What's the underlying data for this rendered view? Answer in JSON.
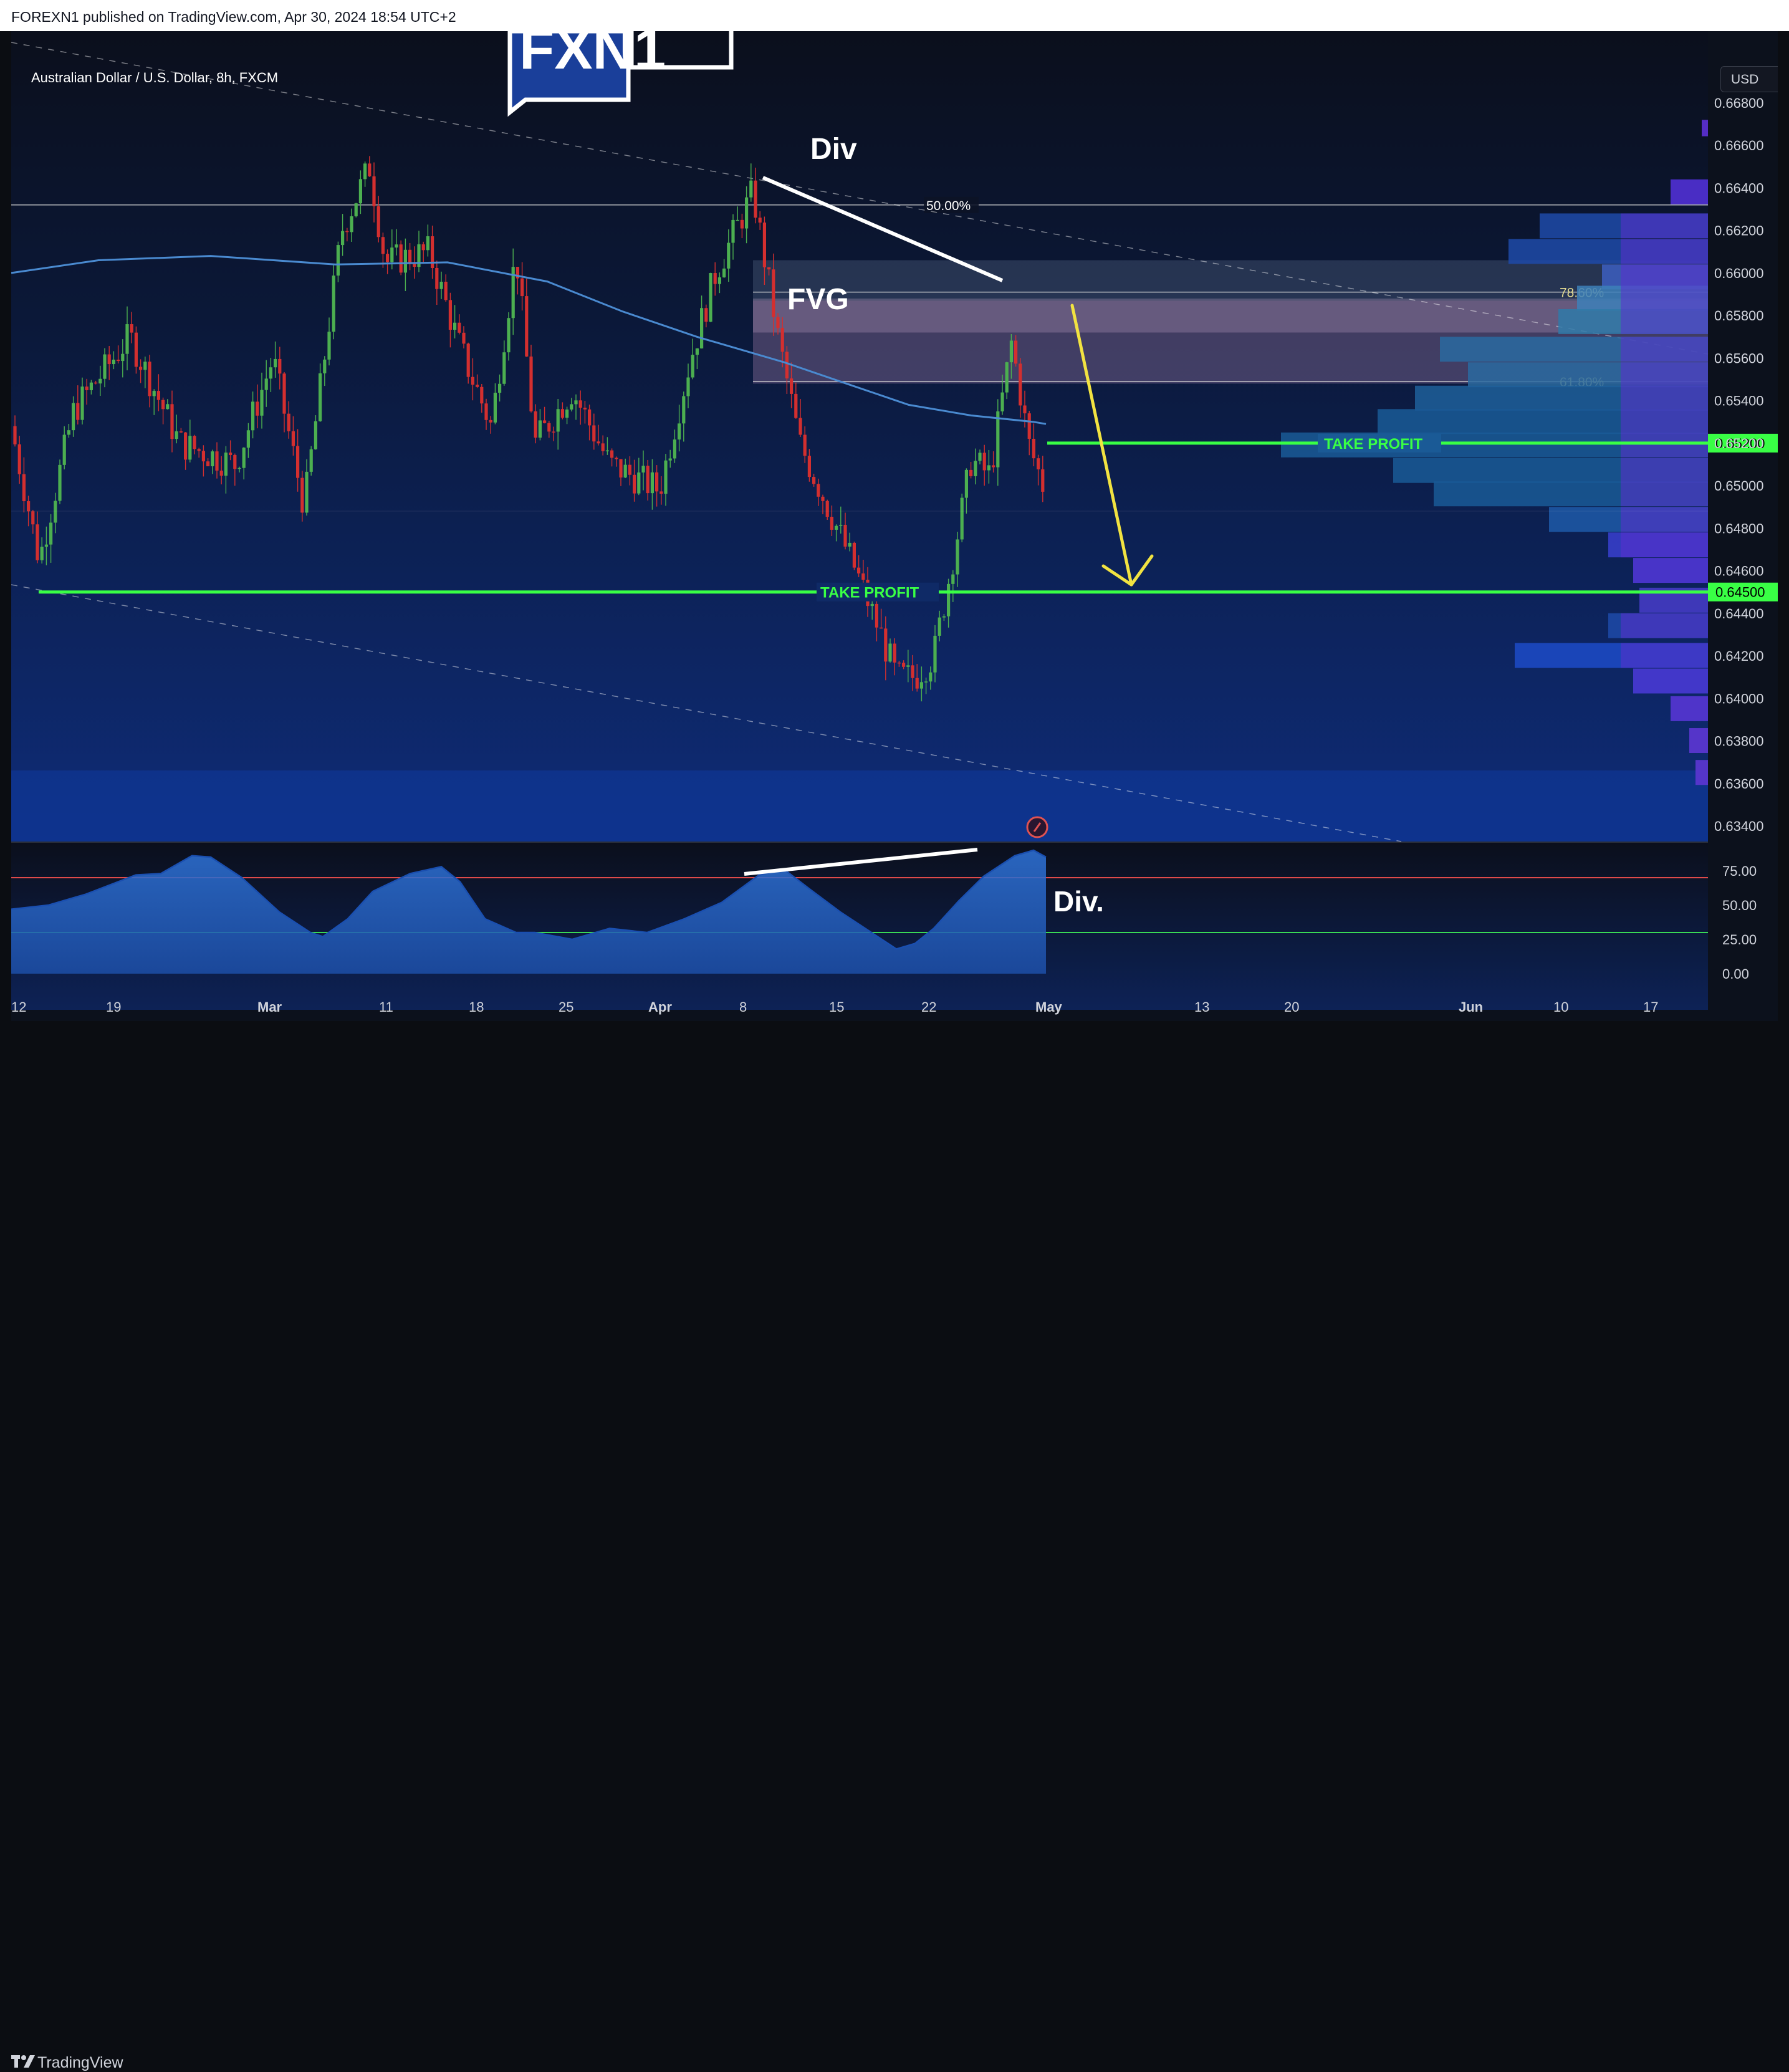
{
  "header": {
    "published": "FOREXN1 published on TradingView.com, Apr 30, 2024 18:54 UTC+2"
  },
  "symbol": {
    "title": "Australian Dollar / U.S. Dollar, 8h, FXCM"
  },
  "currency": "USD",
  "watermark": {
    "text": "FXN1"
  },
  "footer": {
    "brand": "TradingView"
  },
  "annotations": {
    "div_top": "Div",
    "div_bottom": "Div.",
    "fvg": "FVG",
    "take_profit_1": "TAKE PROFIT",
    "take_profit_2": "TAKE PROFIT"
  },
  "colors": {
    "up": "#4caf50",
    "down": "#d32f2f",
    "take_profit": "#39ff45",
    "moving_average": "#4a8ad0",
    "rsi_fill": "#2d6fd1",
    "overbought": "#e04a4a",
    "oversold": "#39d955"
  },
  "chart_data": [
    {
      "type": "candlestick",
      "price_axis": {
        "labels": [
          "0.66800",
          "0.66600",
          "0.66400",
          "0.66200",
          "0.66000",
          "0.65800",
          "0.65600",
          "0.65400",
          "0.65200",
          "0.65000",
          "0.64800",
          "0.64600",
          "0.64400",
          "0.64200",
          "0.64000",
          "0.63800",
          "0.63600",
          "0.63400"
        ],
        "ylim": [
          0.6332,
          0.6714
        ]
      },
      "time_axis": {
        "labels": [
          "12",
          "19",
          "Mar",
          "11",
          "18",
          "25",
          "Apr",
          "8",
          "15",
          "22",
          "May",
          "13",
          "20",
          "Jun",
          "10",
          "17"
        ]
      },
      "fibonacci": [
        {
          "label": "50.00%",
          "price": 0.6632
        },
        {
          "label": "78.60%",
          "price": 0.6591
        },
        {
          "label": "61.80%",
          "price": 0.6549
        }
      ],
      "fvg_zone": {
        "top": 0.6587,
        "bottom": 0.6548
      },
      "resistance_zone": {
        "top": 0.6606,
        "bottom": 0.6587
      },
      "take_profit_levels": [
        {
          "price": 0.652,
          "label": "0.65200"
        },
        {
          "price": 0.645,
          "label": "0.64500"
        }
      ],
      "last_close": 0.6494,
      "projected_target": 0.6453
    },
    {
      "type": "line",
      "name": "RSI",
      "y_axis": {
        "labels": [
          "75.00",
          "50.00",
          "25.00",
          "0.00"
        ],
        "ylim": [
          0,
          100
        ]
      },
      "levels": {
        "overbought": 70,
        "oversold": 30
      }
    }
  ]
}
